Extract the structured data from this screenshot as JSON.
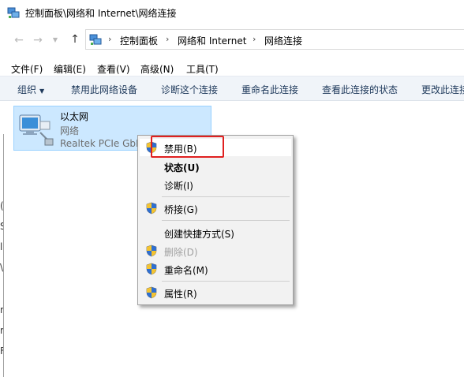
{
  "window": {
    "title": "控制面板\\网络和 Internet\\网络连接"
  },
  "nav": {
    "back_icon": "arrow-left-icon",
    "forward_icon": "arrow-right-icon",
    "recent_icon": "chevron-down-icon",
    "up_icon": "arrow-up-icon"
  },
  "address": {
    "crumbs": [
      "控制面板",
      "网络和 Internet",
      "网络连接"
    ],
    "separator": "›"
  },
  "menubar": {
    "items": [
      "文件(F)",
      "编辑(E)",
      "查看(V)",
      "高级(N)",
      "工具(T)"
    ]
  },
  "commandbar": {
    "organize": "组织",
    "organize_arrow": "▼",
    "items": [
      "禁用此网络设备",
      "诊断这个连接",
      "重命名此连接",
      "查看此连接的状态",
      "更改此连接"
    ]
  },
  "connection": {
    "name": "以太网",
    "type": "网络",
    "device": "Realtek PCIe GbE Family Controller"
  },
  "context_menu": {
    "items": [
      {
        "label": "禁用(B)",
        "shield": true,
        "bold": false,
        "disabled": false
      },
      {
        "label": "状态(U)",
        "shield": false,
        "bold": true,
        "disabled": false
      },
      {
        "label": "诊断(I)",
        "shield": false,
        "bold": false,
        "disabled": false
      },
      {
        "label": "桥接(G)",
        "shield": true,
        "bold": false,
        "disabled": false
      },
      {
        "label": "创建快捷方式(S)",
        "shield": false,
        "bold": false,
        "disabled": false
      },
      {
        "label": "删除(D)",
        "shield": true,
        "bold": false,
        "disabled": true
      },
      {
        "label": "重命名(M)",
        "shield": true,
        "bold": false,
        "disabled": false
      },
      {
        "label": "属性(R)",
        "shield": true,
        "bold": false,
        "disabled": false
      }
    ]
  },
  "left_edge": {
    "glyphs": [
      "(",
      "S",
      "l",
      "\\",
      "r",
      "r",
      "F"
    ]
  },
  "colors": {
    "highlight_box": "#e02020",
    "selection_bg": "#cce8ff",
    "command_text": "#1e395b"
  }
}
